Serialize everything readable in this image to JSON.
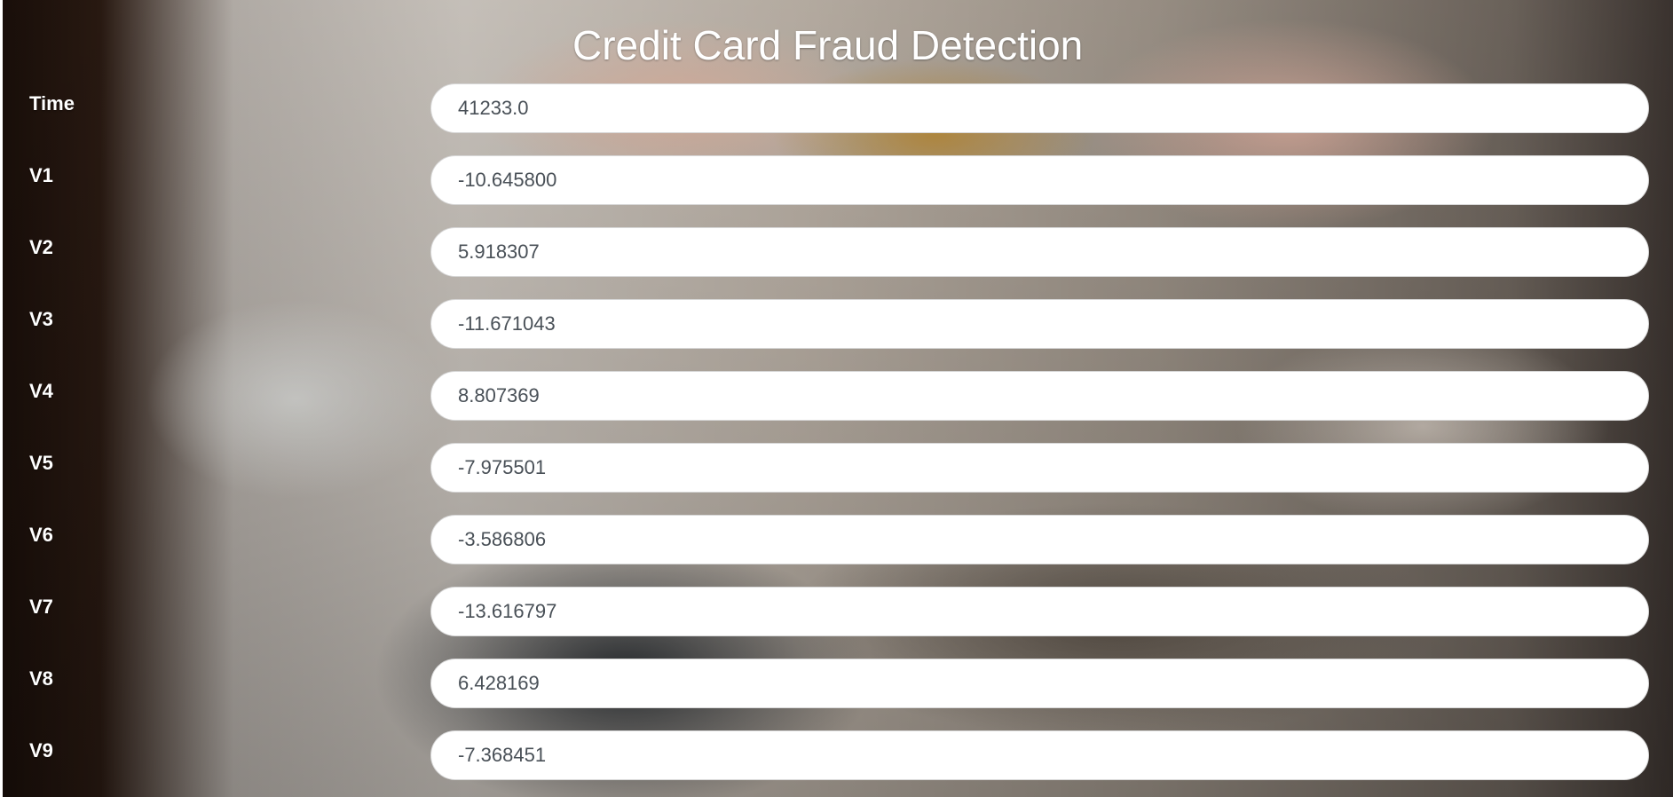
{
  "page": {
    "title": "Credit Card Fraud Detection"
  },
  "form": {
    "fields": [
      {
        "label": "Time",
        "value": "41233.0"
      },
      {
        "label": "V1",
        "value": "-10.645800"
      },
      {
        "label": "V2",
        "value": "5.918307"
      },
      {
        "label": "V3",
        "value": "-11.671043"
      },
      {
        "label": "V4",
        "value": "8.807369"
      },
      {
        "label": "V5",
        "value": "-7.975501"
      },
      {
        "label": "V6",
        "value": "-3.586806"
      },
      {
        "label": "V7",
        "value": "-13.616797"
      },
      {
        "label": "V8",
        "value": "6.428169"
      },
      {
        "label": "V9",
        "value": "-7.368451"
      }
    ]
  },
  "colors": {
    "text_on_background": "#ffffff",
    "input_background": "#ffffff",
    "input_text": "#495057",
    "input_border": "#d7d7d7"
  }
}
